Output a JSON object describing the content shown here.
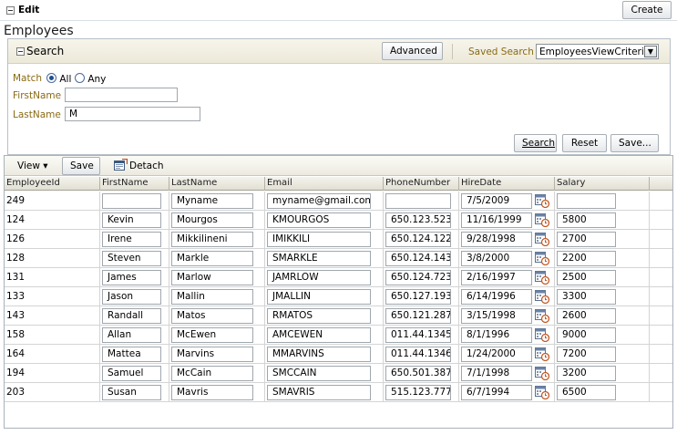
{
  "top_bar": {
    "edit_label": "Edit",
    "create_label": "Create"
  },
  "page_title": "Employees",
  "search": {
    "title": "Search",
    "advanced_label": "Advanced",
    "saved_search_label": "Saved Search",
    "saved_search_value": "EmployeesViewCriteria",
    "match_label": "Match",
    "match_all": "All",
    "match_any": "Any",
    "firstname_label": "FirstName",
    "firstname_value": "",
    "lastname_label": "LastName",
    "lastname_value": "M",
    "search_button": "Search",
    "reset_button": "Reset",
    "save_button": "Save..."
  },
  "table_toolbar": {
    "view_label": "View ▾",
    "save_label": "Save",
    "detach_label": "Detach"
  },
  "columns": [
    "EmployeeId",
    "FirstName",
    "LastName",
    "Email",
    "PhoneNumber",
    "HireDate",
    "Salary"
  ],
  "rows": [
    {
      "id": "249",
      "first": "",
      "last": "Myname",
      "email": "myname@gmail.com",
      "phone": "",
      "hire": "7/5/2009",
      "salary": ""
    },
    {
      "id": "124",
      "first": "Kevin",
      "last": "Mourgos",
      "email": "KMOURGOS",
      "phone": "650.123.523",
      "hire": "11/16/1999",
      "salary": "5800"
    },
    {
      "id": "126",
      "first": "Irene",
      "last": "Mikkilineni",
      "email": "IMIKKILI",
      "phone": "650.124.122",
      "hire": "9/28/1998",
      "salary": "2700"
    },
    {
      "id": "128",
      "first": "Steven",
      "last": "Markle",
      "email": "SMARKLE",
      "phone": "650.124.143",
      "hire": "3/8/2000",
      "salary": "2200"
    },
    {
      "id": "131",
      "first": "James",
      "last": "Marlow",
      "email": "JAMRLOW",
      "phone": "650.124.723",
      "hire": "2/16/1997",
      "salary": "2500"
    },
    {
      "id": "133",
      "first": "Jason",
      "last": "Mallin",
      "email": "JMALLIN",
      "phone": "650.127.193",
      "hire": "6/14/1996",
      "salary": "3300"
    },
    {
      "id": "143",
      "first": "Randall",
      "last": "Matos",
      "email": "RMATOS",
      "phone": "650.121.287",
      "hire": "3/15/1998",
      "salary": "2600"
    },
    {
      "id": "158",
      "first": "Allan",
      "last": "McEwen",
      "email": "AMCEWEN",
      "phone": "011.44.1345",
      "hire": "8/1/1996",
      "salary": "9000"
    },
    {
      "id": "164",
      "first": "Mattea",
      "last": "Marvins",
      "email": "MMARVINS",
      "phone": "011.44.1346",
      "hire": "1/24/2000",
      "salary": "7200"
    },
    {
      "id": "194",
      "first": "Samuel",
      "last": "McCain",
      "email": "SMCCAIN",
      "phone": "650.501.387",
      "hire": "7/1/1998",
      "salary": "3200"
    },
    {
      "id": "203",
      "first": "Susan",
      "last": "Mavris",
      "email": "SMAVRIS",
      "phone": "515.123.777",
      "hire": "6/7/1994",
      "salary": "6500"
    }
  ]
}
